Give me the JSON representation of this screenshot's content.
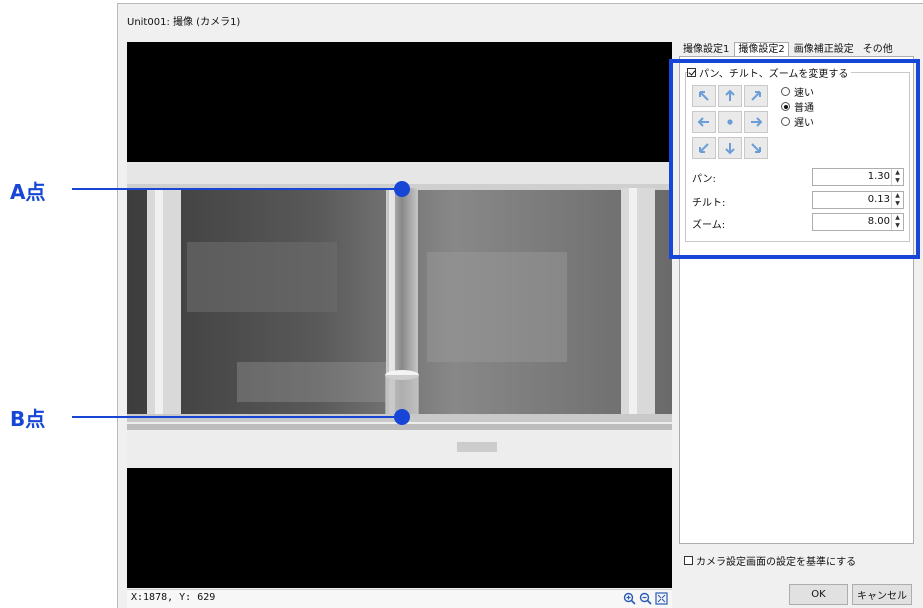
{
  "window": {
    "title": "Unit001: 撮像 (カメラ1)"
  },
  "status": {
    "coords": "X:1878, Y: 629"
  },
  "tabs": [
    {
      "label": "撮像設定1",
      "active": false
    },
    {
      "label": "撮像設定2",
      "active": true
    },
    {
      "label": "画像補正設定",
      "active": false
    },
    {
      "label": "その他",
      "active": false
    }
  ],
  "ptz": {
    "group_label": "パン、チルト、ズームを変更する",
    "group_checked": true,
    "speed_options": [
      {
        "label": "速い",
        "selected": false
      },
      {
        "label": "普通",
        "selected": true
      },
      {
        "label": "遅い",
        "selected": false
      }
    ],
    "pan": {
      "label": "パン:",
      "value": "1.30"
    },
    "tilt": {
      "label": "チルト:",
      "value": "0.13"
    },
    "zoom": {
      "label": "ズーム:",
      "value": "8.00"
    }
  },
  "base_option": {
    "label": "カメラ設定画面の設定を基準にする",
    "checked": false
  },
  "buttons": {
    "ok": "OK",
    "cancel": "キャンセル"
  },
  "annotations": {
    "point_a": "A点",
    "point_b": "B点"
  },
  "colors": {
    "accent": "#1746d6",
    "window_bg": "#f0f0f0",
    "viewer_bg": "#000000"
  }
}
